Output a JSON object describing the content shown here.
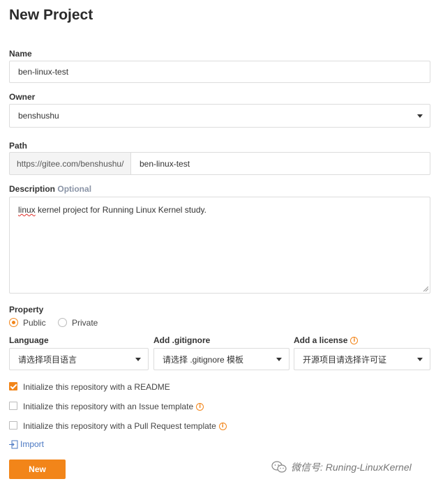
{
  "page": {
    "title": "New Project"
  },
  "name": {
    "label": "Name",
    "value": "ben-linux-test"
  },
  "owner": {
    "label": "Owner",
    "value": "benshushu"
  },
  "path": {
    "label": "Path",
    "prefix": "https://gitee.com/benshushu/",
    "value": "ben-linux-test"
  },
  "description": {
    "label": "Description",
    "optional": "Optional",
    "value_word1": "linux",
    "value_rest": " kernel project for Running Linux Kernel study."
  },
  "property": {
    "label": "Property",
    "options": [
      {
        "label": "Public",
        "selected": true
      },
      {
        "label": "Private",
        "selected": false
      }
    ]
  },
  "language": {
    "label": "Language",
    "value": "请选择项目语言"
  },
  "gitignore": {
    "label": "Add .gitignore",
    "value": "请选择 .gitignore 模板"
  },
  "license": {
    "label": "Add a license",
    "value": "开源项目请选择许可证"
  },
  "checks": [
    {
      "label": "Initialize this repository with a README",
      "checked": true
    },
    {
      "label": "Initialize this repository with an Issue template",
      "checked": false
    },
    {
      "label": "Initialize this repository with a Pull Request template",
      "checked": false
    }
  ],
  "import": {
    "label": "Import"
  },
  "submit": {
    "label": "New"
  },
  "watermark": {
    "text": "微信号: Runing-LinuxKernel"
  },
  "colors": {
    "accent": "#f28519",
    "link": "#4a77c2",
    "border": "#dcdcdc"
  }
}
